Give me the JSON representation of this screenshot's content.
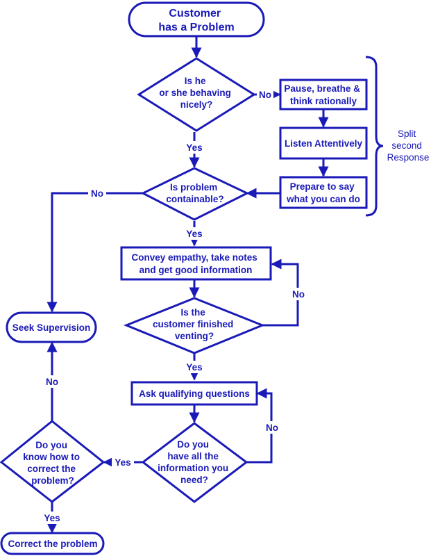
{
  "diagram": {
    "type": "flowchart",
    "nodes": {
      "start": [
        "Customer",
        "has a Problem"
      ],
      "behaving": [
        "Is he",
        "or she behaving",
        "nicely?"
      ],
      "pause": [
        "Pause, breathe &",
        "think rationally"
      ],
      "listen": [
        "Listen Attentively"
      ],
      "prepare": [
        "Prepare to say",
        "what you can do"
      ],
      "containable": [
        "Is problem",
        "containable?"
      ],
      "convey": [
        "Convey empathy, take notes",
        "and get good information"
      ],
      "venting": [
        "Is the",
        "customer finished",
        "venting?"
      ],
      "ask": [
        "Ask qualifying questions"
      ],
      "info": [
        "Do you",
        "have all the",
        "information you",
        "need?"
      ],
      "know": [
        "Do you",
        "know how to",
        "correct the",
        "problem?"
      ],
      "supervision": [
        "Seek Supervision"
      ],
      "correct": [
        "Correct the problem"
      ]
    },
    "edge_labels": {
      "behaving_no": "No",
      "behaving_yes": "Yes",
      "containable_no": "No",
      "containable_yes": "Yes",
      "venting_no": "No",
      "venting_yes": "Yes",
      "info_no": "No",
      "info_yes": "Yes",
      "know_no": "No",
      "know_yes": "Yes"
    },
    "brace_note": [
      "Split",
      "second",
      "Response"
    ],
    "colors": {
      "stroke": "#1a1ab8",
      "text": "#1a1ab8",
      "background": "#ffffff"
    }
  }
}
